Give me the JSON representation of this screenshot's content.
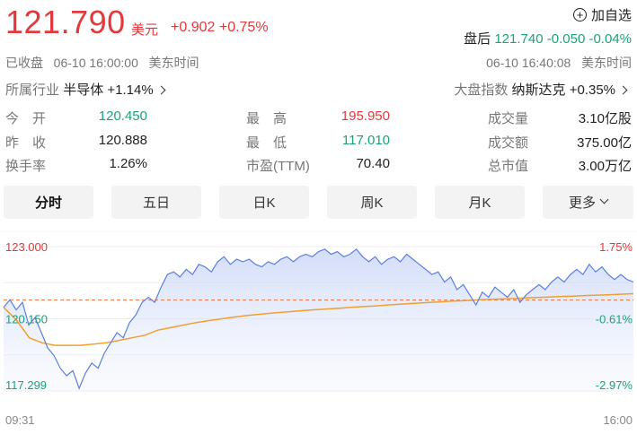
{
  "header": {
    "price": "121.790",
    "currency": "美元",
    "change_abs": "+0.902",
    "change_pct": "+0.75%",
    "watch_label": "加自选",
    "after_label": "盘后",
    "after_price": "121.740",
    "after_change_abs": "-0.050",
    "after_change_pct": "-0.04%",
    "status": "已收盘",
    "close_time": "06-10 16:00:00",
    "tz_left": "美东时间",
    "after_time": "06-10 16:40:08",
    "tz_right": "美东时间",
    "industry_label": "所属行业",
    "industry_name": "半导体",
    "industry_pct": "+1.14%",
    "index_label": "大盘指数",
    "index_name": "纳斯达克",
    "index_pct": "+0.35%"
  },
  "stats": [
    {
      "key": "今　开",
      "value": "120.450",
      "tone": "green"
    },
    {
      "key": "最　高",
      "value": "195.950",
      "tone": "red"
    },
    {
      "key": "成交量",
      "value": "3.10亿股",
      "tone": "dark"
    },
    {
      "key": "昨　收",
      "value": "120.888",
      "tone": "dark"
    },
    {
      "key": "最　低",
      "value": "117.010",
      "tone": "green"
    },
    {
      "key": "成交额",
      "value": "375.00亿",
      "tone": "dark"
    },
    {
      "key": "换手率",
      "value": "1.26%",
      "tone": "dark"
    },
    {
      "key": "市盈(TTM)",
      "value": "70.40",
      "tone": "dark"
    },
    {
      "key": "总市值",
      "value": "3.00万亿",
      "tone": "dark"
    }
  ],
  "tabs": [
    {
      "label": "分时",
      "active": true
    },
    {
      "label": "五日",
      "active": false
    },
    {
      "label": "日K",
      "active": false
    },
    {
      "label": "周K",
      "active": false
    },
    {
      "label": "月K",
      "active": false
    },
    {
      "label": "更多",
      "active": false
    }
  ],
  "chart_data": {
    "type": "line",
    "x_start": "09:31",
    "x_end": "16:00",
    "ylim": [
      117.299,
      123.0
    ],
    "y_tick_labels_left": [
      "123.000",
      "120.150",
      "117.299"
    ],
    "y_tick_labels_right": [
      "1.75%",
      "-0.61%",
      "-2.97%"
    ],
    "ref_value": 120.888,
    "grid": true,
    "series": [
      {
        "role": "price",
        "color": "#5b7fe0",
        "values": [
          120.6,
          120.9,
          120.5,
          120.8,
          119.9,
          120.2,
          119.6,
          119.0,
          118.7,
          118.2,
          117.9,
          118.1,
          117.4,
          118.0,
          118.4,
          118.2,
          118.8,
          119.2,
          119.6,
          119.4,
          120.0,
          120.3,
          120.8,
          121.0,
          120.8,
          121.4,
          121.9,
          122.0,
          121.8,
          122.1,
          121.9,
          122.3,
          122.2,
          122.0,
          122.4,
          122.6,
          122.3,
          122.5,
          122.4,
          122.5,
          122.3,
          122.2,
          122.4,
          122.3,
          122.5,
          122.6,
          122.4,
          122.6,
          122.7,
          122.6,
          122.8,
          122.9,
          122.7,
          122.8,
          122.6,
          122.7,
          122.9,
          122.6,
          122.4,
          122.6,
          122.3,
          122.5,
          122.6,
          122.4,
          122.7,
          122.5,
          122.3,
          122.1,
          121.9,
          122.0,
          121.6,
          121.8,
          121.3,
          121.5,
          121.1,
          120.7,
          121.2,
          121.0,
          121.4,
          121.2,
          121.0,
          121.3,
          120.8,
          121.1,
          121.3,
          121.5,
          121.3,
          121.6,
          121.8,
          121.6,
          121.9,
          122.1,
          121.9,
          122.3,
          122.0,
          122.2,
          121.9,
          121.7,
          121.9,
          121.7,
          121.6
        ]
      },
      {
        "role": "average",
        "color": "#f0a030",
        "values": [
          120.6,
          120.1,
          119.4,
          119.2,
          119.1,
          119.1,
          119.1,
          119.15,
          119.2,
          119.3,
          119.4,
          119.5,
          119.7,
          119.8,
          119.9,
          120.0,
          120.08,
          120.15,
          120.22,
          120.28,
          120.33,
          120.38,
          120.42,
          120.46,
          120.5,
          120.53,
          120.56,
          120.6,
          120.63,
          120.66,
          120.7,
          120.73,
          120.76,
          120.79,
          120.82,
          120.85,
          120.87,
          120.9,
          120.92,
          120.94,
          120.96,
          120.98,
          121.0,
          121.02,
          121.04,
          121.06,
          121.08,
          121.1,
          121.12,
          121.14
        ]
      }
    ]
  }
}
